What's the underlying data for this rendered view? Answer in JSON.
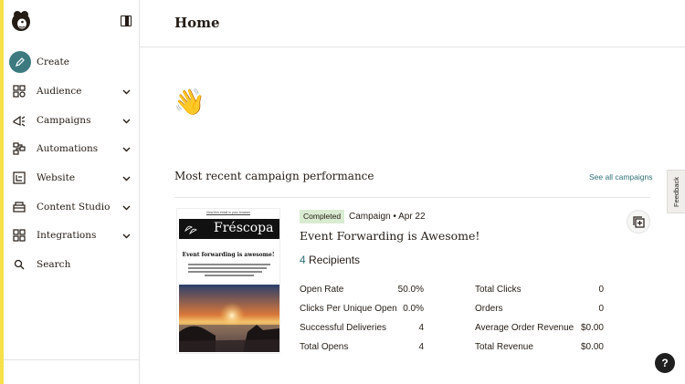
{
  "header": {
    "title": "Home"
  },
  "sidebar": {
    "items": [
      {
        "label": "Create",
        "icon": "pencil-icon"
      },
      {
        "label": "Audience",
        "icon": "audience-icon"
      },
      {
        "label": "Campaigns",
        "icon": "megaphone-icon"
      },
      {
        "label": "Automations",
        "icon": "automations-icon"
      },
      {
        "label": "Website",
        "icon": "website-icon"
      },
      {
        "label": "Content Studio",
        "icon": "content-studio-icon"
      },
      {
        "label": "Integrations",
        "icon": "integrations-icon"
      },
      {
        "label": "Search",
        "icon": "search-icon"
      }
    ]
  },
  "greeting": {
    "emoji": "👋"
  },
  "section": {
    "title": "Most recent campaign performance",
    "see_all": "See all campaigns"
  },
  "feedback": {
    "label": "Feedback"
  },
  "campaign": {
    "status": "Completed",
    "meta": "Campaign • Apr 22",
    "title": "Event Forwarding is Awesome!",
    "recipients_count": "4",
    "recipients_label": "Recipients",
    "thumbnail": {
      "top_link": "View this email in your browser",
      "brand": "Fréscopa",
      "headline": "Event forwarding is awesome!"
    },
    "stats_left": [
      {
        "label": "Open Rate",
        "value": "50.0%"
      },
      {
        "label": "Clicks Per Unique Open",
        "value": "0.0%"
      },
      {
        "label": "Successful Deliveries",
        "value": "4"
      },
      {
        "label": "Total Opens",
        "value": "4"
      }
    ],
    "stats_right": [
      {
        "label": "Total Clicks",
        "value": "0"
      },
      {
        "label": "Orders",
        "value": "0"
      },
      {
        "label": "Average Order Revenue",
        "value": "$0.00"
      },
      {
        "label": "Total Revenue",
        "value": "$0.00"
      }
    ]
  },
  "help": {
    "label": "?"
  },
  "colors": {
    "accent": "#3c7a80",
    "badge": "#d9ebd0",
    "edge": "#f7e04b"
  }
}
